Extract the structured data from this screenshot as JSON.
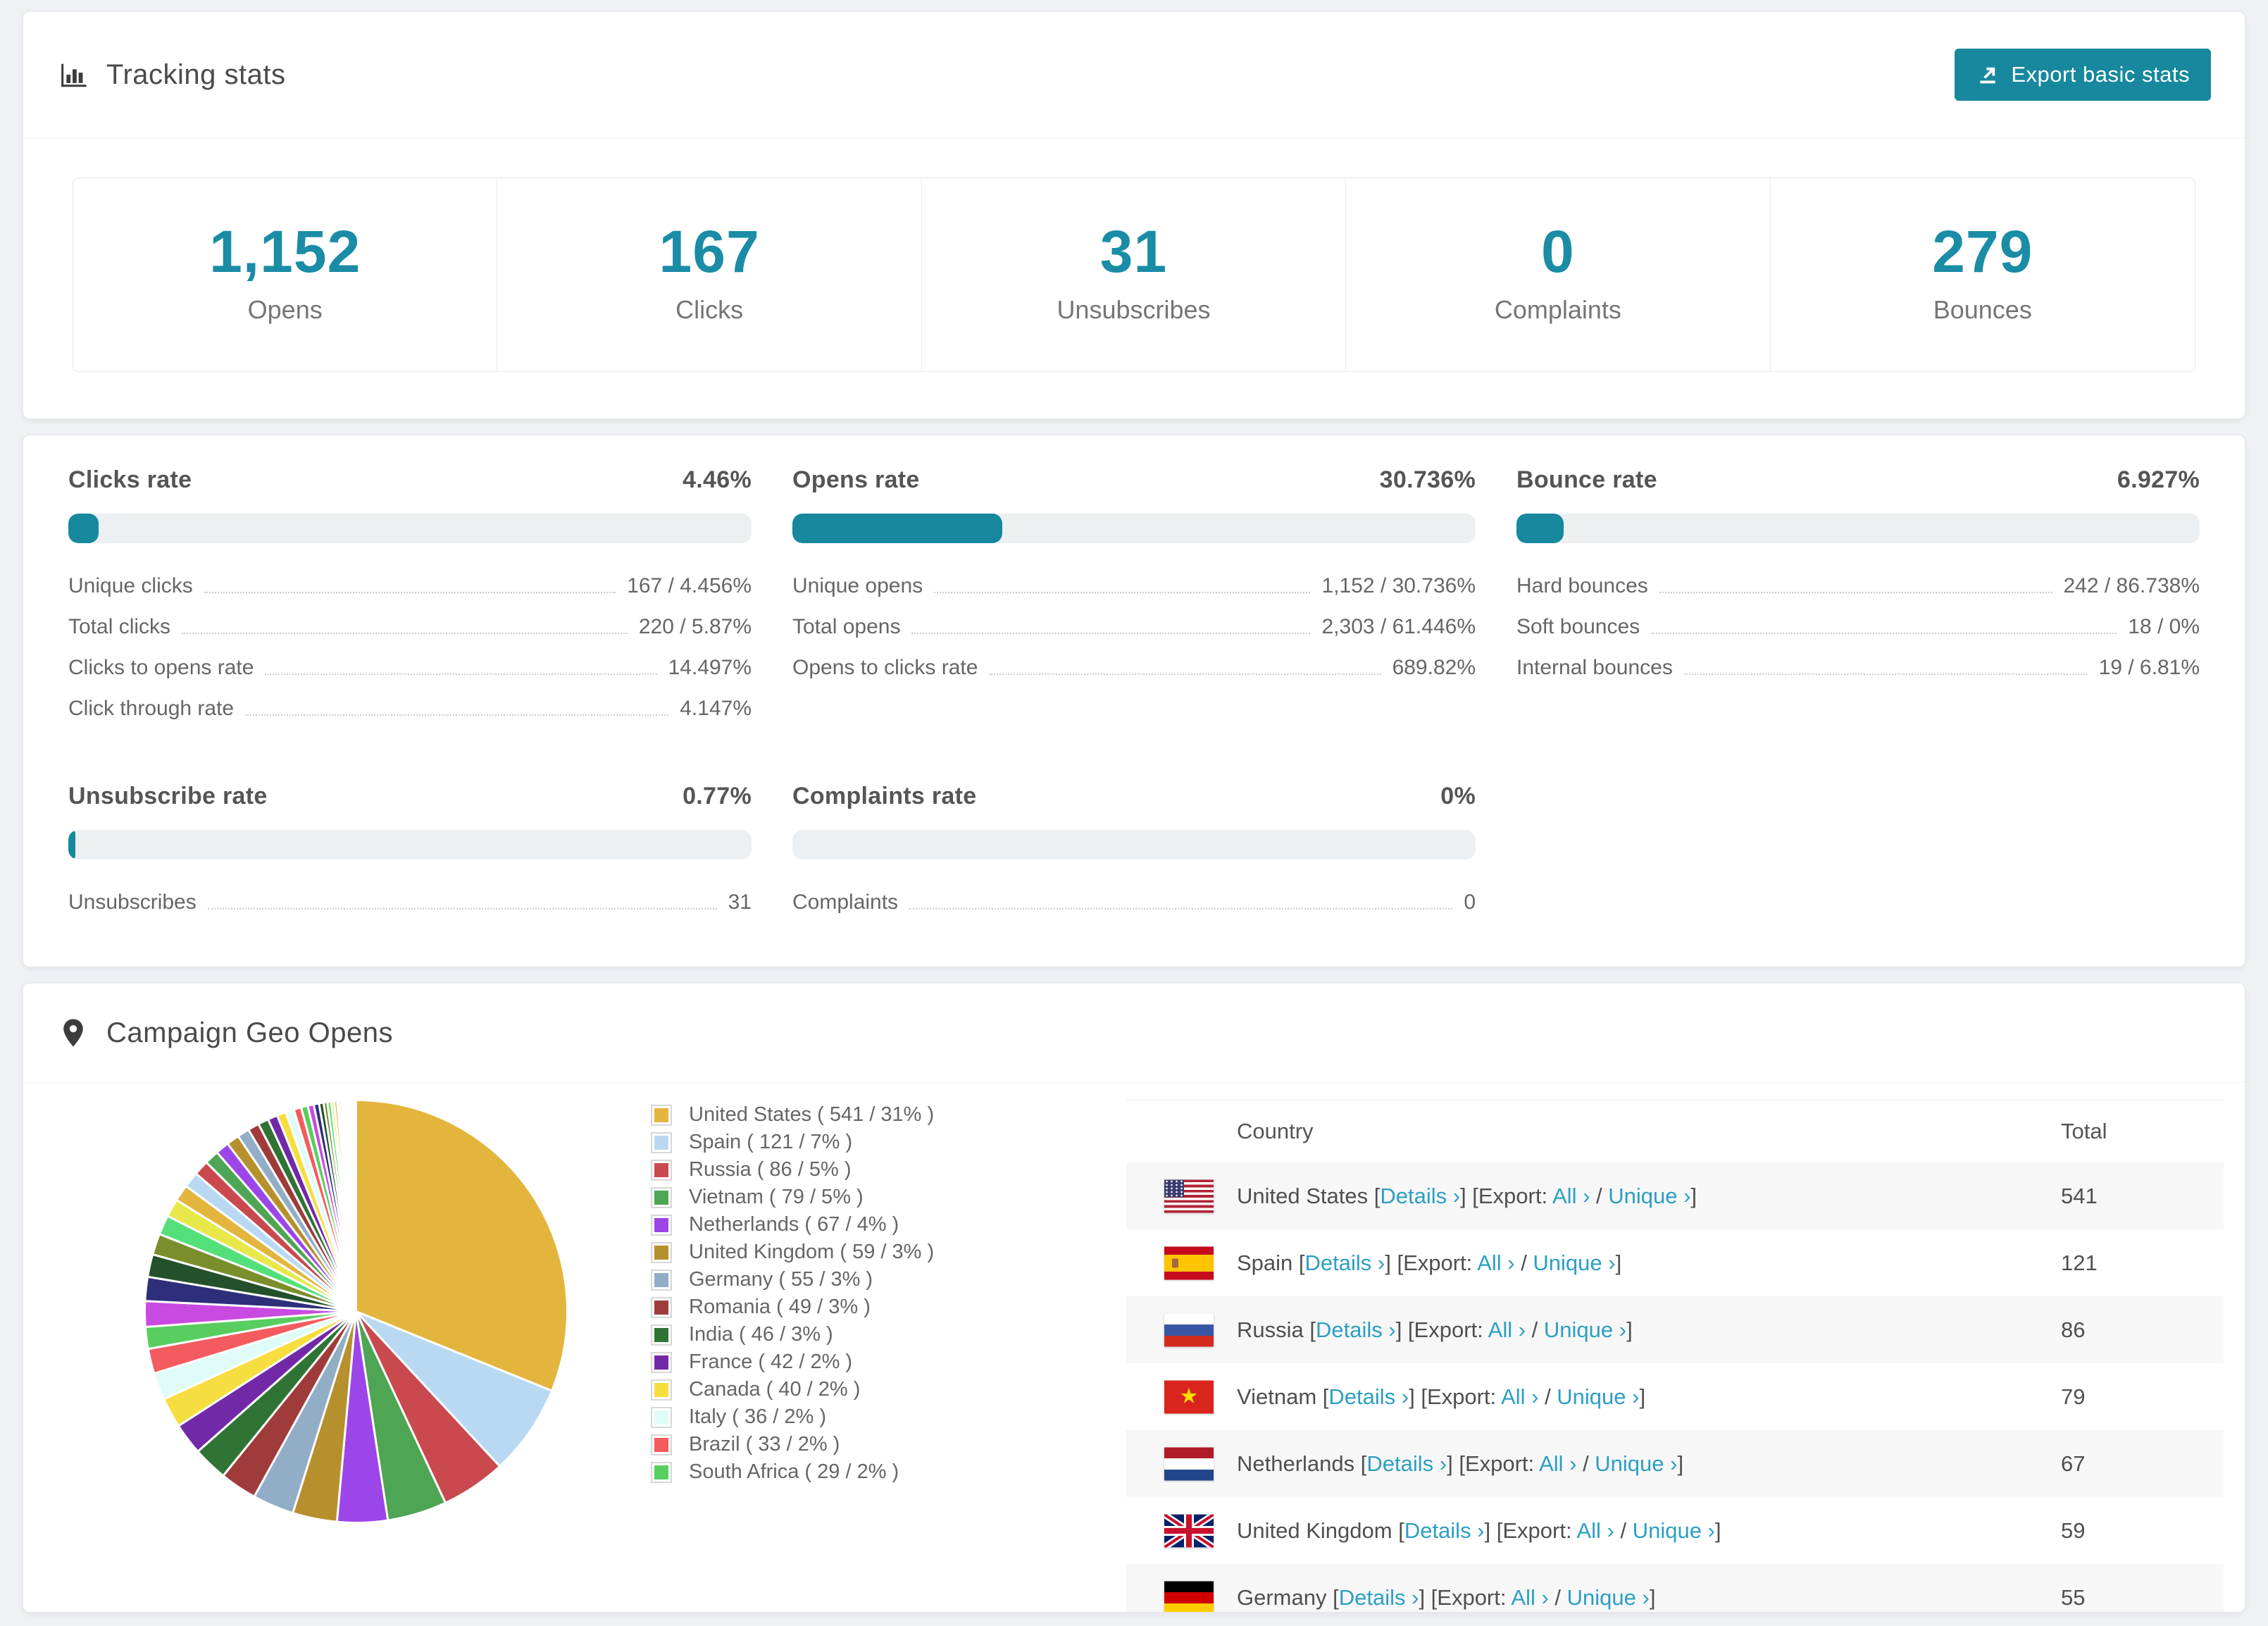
{
  "accent": "#17889D",
  "number_color": "#1A8CA6",
  "link_color": "#2C9FC2",
  "page_bg": "#EFF1F4",
  "tracking": {
    "title": "Tracking stats",
    "export_button": "Export basic stats",
    "stats": [
      {
        "value": "1,152",
        "label": "Opens"
      },
      {
        "value": "167",
        "label": "Clicks"
      },
      {
        "value": "31",
        "label": "Unsubscribes"
      },
      {
        "value": "0",
        "label": "Complaints"
      },
      {
        "value": "279",
        "label": "Bounces"
      }
    ]
  },
  "rates": {
    "sections": [
      {
        "title": "Clicks rate",
        "value": "4.46%",
        "bar_pct": 4.46,
        "rows": [
          {
            "label": "Unique clicks",
            "value": "167 / 4.456%"
          },
          {
            "label": "Total clicks",
            "value": "220 / 5.87%"
          },
          {
            "label": "Clicks to opens rate",
            "value": "14.497%"
          },
          {
            "label": "Click through rate",
            "value": "4.147%"
          }
        ]
      },
      {
        "title": "Opens rate",
        "value": "30.736%",
        "bar_pct": 30.736,
        "rows": [
          {
            "label": "Unique opens",
            "value": "1,152 / 30.736%"
          },
          {
            "label": "Total opens",
            "value": "2,303 / 61.446%"
          },
          {
            "label": "Opens to clicks rate",
            "value": "689.82%"
          }
        ]
      },
      {
        "title": "Bounce rate",
        "value": "6.927%",
        "bar_pct": 6.927,
        "rows": [
          {
            "label": "Hard bounces",
            "value": "242 / 86.738%"
          },
          {
            "label": "Soft bounces",
            "value": "18 / 0%"
          },
          {
            "label": "Internal bounces",
            "value": "19 / 6.81%"
          }
        ]
      },
      {
        "title": "Unsubscribe rate",
        "value": "0.77%",
        "bar_pct": 0.77,
        "rows": [
          {
            "label": "Unsubscribes",
            "value": "31"
          }
        ]
      },
      {
        "title": "Complaints rate",
        "value": "0%",
        "bar_pct": 0,
        "rows": [
          {
            "label": "Complaints",
            "value": "0"
          }
        ]
      }
    ]
  },
  "geo": {
    "title": "Campaign Geo Opens",
    "legend": [
      {
        "name": "United States",
        "count": "541",
        "pct": "31"
      },
      {
        "name": "Spain",
        "count": "121",
        "pct": "7"
      },
      {
        "name": "Russia",
        "count": "86",
        "pct": "5"
      },
      {
        "name": "Vietnam",
        "count": "79",
        "pct": "5"
      },
      {
        "name": "Netherlands",
        "count": "67",
        "pct": "4"
      },
      {
        "name": "United Kingdom",
        "count": "59",
        "pct": "3"
      },
      {
        "name": "Germany",
        "count": "55",
        "pct": "3"
      },
      {
        "name": "Romania",
        "count": "49",
        "pct": "3"
      },
      {
        "name": "India",
        "count": "46",
        "pct": "3"
      },
      {
        "name": "France",
        "count": "42",
        "pct": "2"
      },
      {
        "name": "Canada",
        "count": "40",
        "pct": "2"
      },
      {
        "name": "Italy",
        "count": "36",
        "pct": "2"
      },
      {
        "name": "Brazil",
        "count": "33",
        "pct": "2"
      },
      {
        "name": "South Africa",
        "count": "29",
        "pct": "2"
      }
    ],
    "table": {
      "columns": [
        "Country",
        "Total"
      ],
      "punct": {
        "open": "[",
        "close": "]",
        "slash": " / ",
        "space": " ",
        "chevron": "›"
      },
      "link_labels": {
        "details": "Details",
        "export_prefix": "Export: ",
        "all": "All",
        "unique": "Unique"
      },
      "rows": [
        {
          "flag": "us",
          "country": "United States",
          "total": "541"
        },
        {
          "flag": "es",
          "country": "Spain",
          "total": "121"
        },
        {
          "flag": "ru",
          "country": "Russia",
          "total": "86"
        },
        {
          "flag": "vn",
          "country": "Vietnam",
          "total": "79"
        },
        {
          "flag": "nl",
          "country": "Netherlands",
          "total": "67"
        },
        {
          "flag": "gb",
          "country": "United Kingdom",
          "total": "59"
        },
        {
          "flag": "de",
          "country": "Germany",
          "total": "55"
        }
      ]
    }
  },
  "chart_data": {
    "type": "pie",
    "title": "Campaign Geo Opens",
    "unit": "opens",
    "legend_position": "right",
    "start_angle_deg": -90,
    "direction": "clockwise",
    "slices": [
      {
        "label": "United States",
        "value": 541,
        "pct_label": "31%"
      },
      {
        "label": "Spain",
        "value": 121,
        "pct_label": "7%"
      },
      {
        "label": "Russia",
        "value": 86,
        "pct_label": "5%"
      },
      {
        "label": "Vietnam",
        "value": 79,
        "pct_label": "5%"
      },
      {
        "label": "Netherlands",
        "value": 67,
        "pct_label": "4%"
      },
      {
        "label": "United Kingdom",
        "value": 59,
        "pct_label": "3%"
      },
      {
        "label": "Germany",
        "value": 55,
        "pct_label": "3%"
      },
      {
        "label": "Romania",
        "value": 49,
        "pct_label": "3%"
      },
      {
        "label": "India",
        "value": 46,
        "pct_label": "3%"
      },
      {
        "label": "France",
        "value": 42,
        "pct_label": "2%"
      },
      {
        "label": "Canada",
        "value": 40,
        "pct_label": "2%"
      },
      {
        "label": "Italy",
        "value": 36,
        "pct_label": "2%"
      },
      {
        "label": "Brazil",
        "value": 33,
        "pct_label": "2%"
      },
      {
        "label": "South Africa",
        "value": 29,
        "pct_label": "2%"
      }
    ],
    "other_slice_values": [
      34,
      32,
      30,
      28,
      26,
      24,
      22,
      21,
      20,
      19,
      18,
      17,
      16,
      15,
      14,
      13,
      12,
      11,
      10,
      9,
      8,
      7,
      6,
      5,
      5,
      4,
      4,
      3,
      3,
      2,
      2,
      2,
      2,
      1.5,
      1.5,
      1,
      1,
      1,
      1,
      1,
      0.8,
      0.6,
      0.5,
      0.4,
      0.3,
      0.2
    ],
    "palette": [
      "#E3B53C",
      "#B9D9F3",
      "#C9494E",
      "#4EA553",
      "#9C45E8",
      "#B5902C",
      "#92ADC6",
      "#A03B3B",
      "#2F7434",
      "#7229A8",
      "#F6DE41",
      "#DFFCF8",
      "#F45B5E",
      "#57CE5F",
      "#C94AE0",
      "#2E2E7A",
      "#24512B",
      "#7A8E2C",
      "#53E07A",
      "#E8E84A"
    ]
  }
}
